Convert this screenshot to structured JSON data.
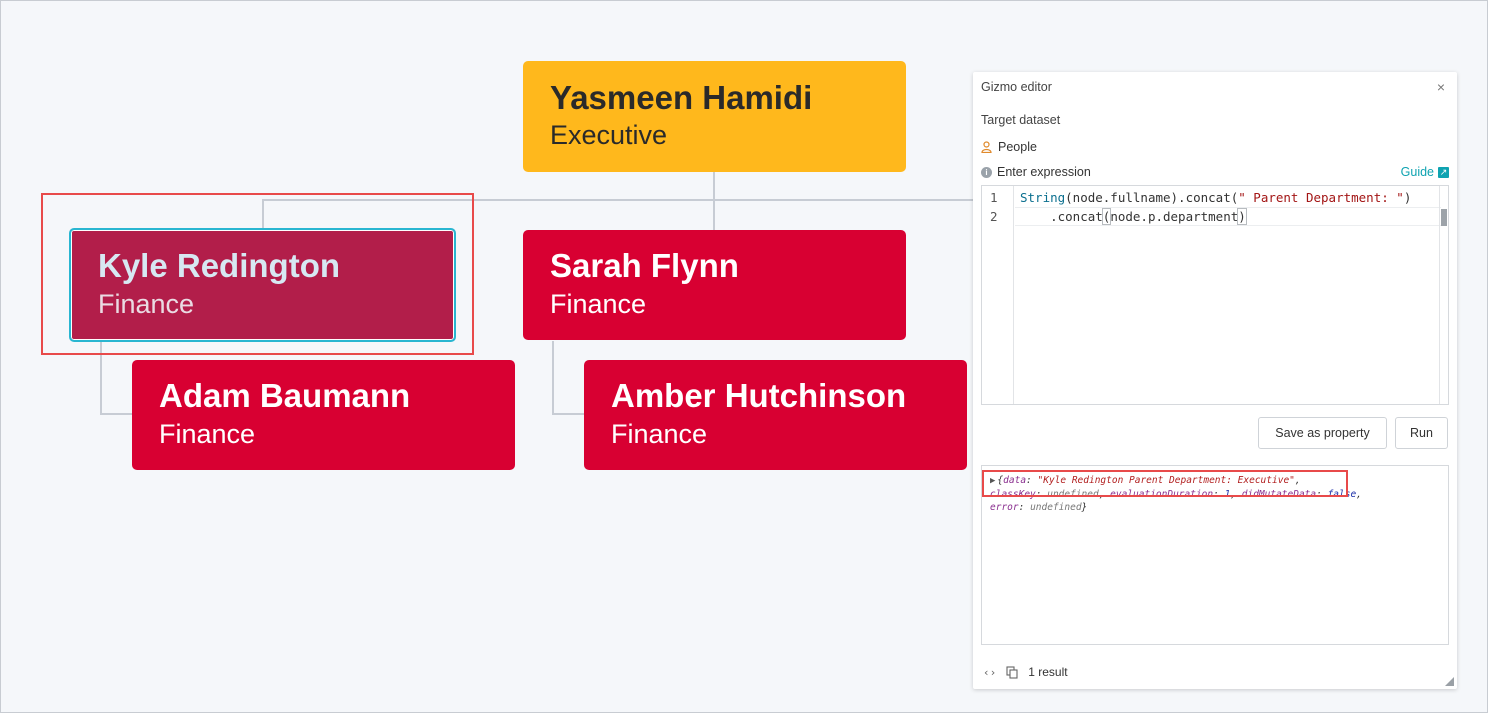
{
  "chart": {
    "root": {
      "name": "Yasmeen Hamidi",
      "department": "Executive"
    },
    "nodes": [
      {
        "name": "Kyle Redington",
        "department": "Finance"
      },
      {
        "name": "Sarah Flynn",
        "department": "Finance"
      },
      {
        "name": "Adam Baumann",
        "department": "Finance"
      },
      {
        "name": "Amber Hutchinson",
        "department": "Finance"
      }
    ]
  },
  "panel": {
    "title": "Gizmo editor",
    "close": "×",
    "target_label": "Target dataset",
    "dataset": "People",
    "expr_label": "Enter expression",
    "guide": "Guide",
    "editor": {
      "line_numbers": [
        "1",
        "2"
      ],
      "line1": {
        "fn": "String",
        "a": "(node.fullname).concat(",
        "str": "\" Parent Department: \"",
        "b": ")"
      },
      "line2": {
        "indent": "    .concat",
        "open": "(",
        "mid": "node.p.department",
        "close": ")"
      }
    },
    "buttons": {
      "save": "Save as property",
      "run": "Run"
    },
    "output": {
      "l1_open": "{",
      "k_data": "data",
      "v_data": "\"Kyle Redington Parent Department: Executive\"",
      "k_classkey": "classKey",
      "v_undef": "undefined",
      "k_evalduration": "evaluationDuration",
      "v_evalduration": "1",
      "k_didmutate": "didMutateData",
      "v_false": "false",
      "k_error": "error",
      "close_brace": "}"
    },
    "footer": {
      "result": "1 result"
    }
  },
  "colors": {
    "executive": "#ffb81c",
    "finance": "#d80032",
    "selected": "#b21e4a",
    "accent": "#0fa3b1",
    "highlight": "#e84a4a"
  }
}
